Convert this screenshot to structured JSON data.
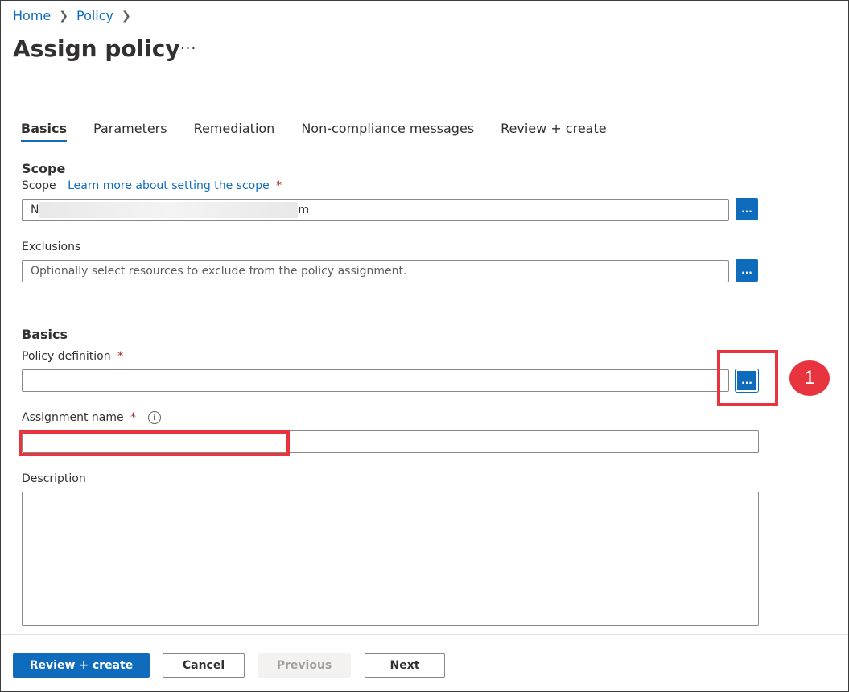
{
  "breadcrumb": {
    "items": [
      "Home",
      "Policy"
    ]
  },
  "page": {
    "title": "Assign policy",
    "more": "···"
  },
  "tabs": [
    "Basics",
    "Parameters",
    "Remediation",
    "Non-compliance messages",
    "Review + create"
  ],
  "scope_section": {
    "heading": "Scope",
    "scope_label": "Scope",
    "scope_link": "Learn more about setting the scope",
    "required_mark": "*",
    "scope_value_start": "N",
    "scope_value_end": "m",
    "browse_label": "...",
    "exclusions_label": "Exclusions",
    "exclusions_placeholder": "Optionally select resources to exclude from the policy assignment."
  },
  "basics_section": {
    "heading": "Basics",
    "policy_definition_label": "Policy definition",
    "assignment_name_label": "Assignment name",
    "info_glyph": "i",
    "description_label": "Description"
  },
  "callout": {
    "number": "1"
  },
  "footer": {
    "review_create": "Review + create",
    "cancel": "Cancel",
    "previous": "Previous",
    "next": "Next"
  },
  "colors": {
    "accent": "#0f6cbd",
    "highlight": "#e8343e",
    "required": "#a4262c"
  }
}
